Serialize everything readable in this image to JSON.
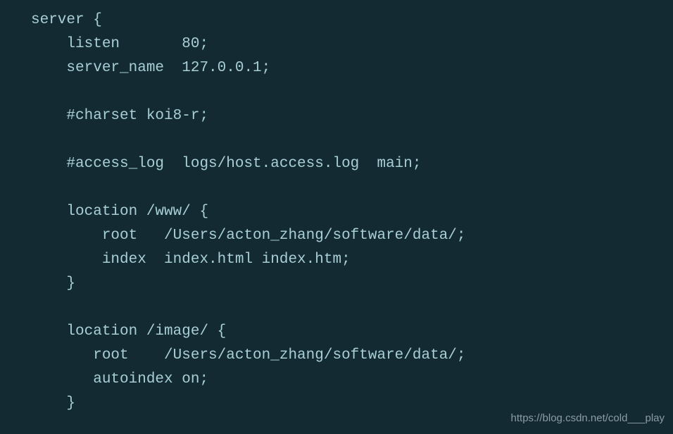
{
  "code": {
    "line1": "server {",
    "line2": "    listen       80;",
    "line3": "    server_name  127.0.0.1;",
    "line4": "",
    "line5": "    #charset koi8-r;",
    "line6": "",
    "line7": "    #access_log  logs/host.access.log  main;",
    "line8": "",
    "line9": "    location /www/ {",
    "line10": "        root   /Users/acton_zhang/software/data/;",
    "line11": "        index  index.html index.htm;",
    "line12": "    }",
    "line13": "",
    "line14": "    location /image/ {",
    "line15": "       root    /Users/acton_zhang/software/data/;",
    "line16": "       autoindex on;",
    "line17": "    }"
  },
  "watermark": "https://blog.csdn.net/cold___play"
}
